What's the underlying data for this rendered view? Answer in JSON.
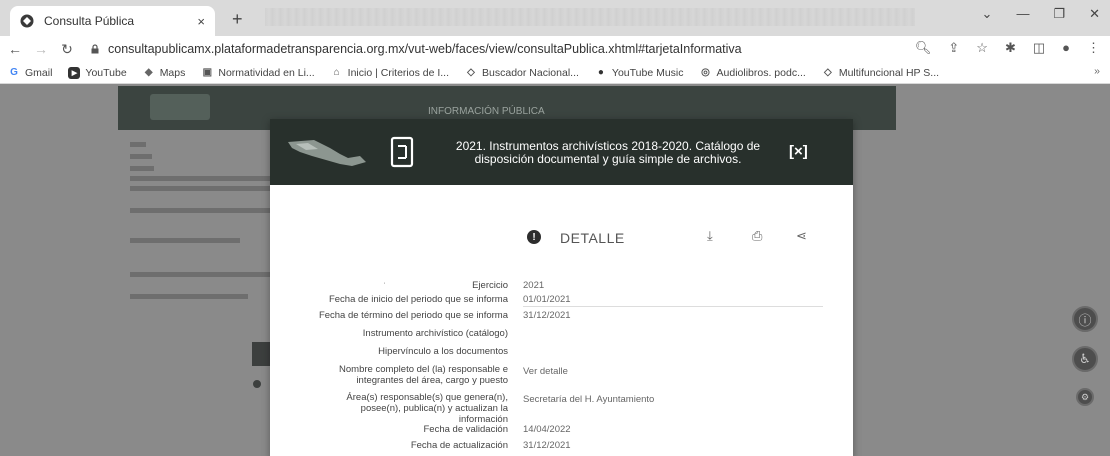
{
  "browser": {
    "tab_title": "Consulta Pública",
    "tab_close": "×",
    "new_tab": "+",
    "url": "consultapublicamx.plataformadetransparencia.org.mx/vut-web/faces/view/consultaPublica.xhtml#tarjetaInformativa",
    "bookmarks": [
      {
        "label": "Gmail",
        "icon": "G"
      },
      {
        "label": "YouTube",
        "icon": "▶"
      },
      {
        "label": "Maps",
        "icon": "◆"
      },
      {
        "label": "Normatividad en Li...",
        "icon": "▣"
      },
      {
        "label": "Inicio | Criterios de I...",
        "icon": "⌂"
      },
      {
        "label": "Buscador Nacional...",
        "icon": "◇"
      },
      {
        "label": "YouTube Music",
        "icon": "●"
      },
      {
        "label": "Audiolibros. podc...",
        "icon": "◎"
      },
      {
        "label": "Multifuncional HP S...",
        "icon": "◇"
      }
    ],
    "bookmarks_more": "»"
  },
  "background_page": {
    "header_title": "INFORMACIÓN PÚBLICA"
  },
  "modal": {
    "title_line1": "2021. Instrumentos archivísticos 2018-2020. Catálogo de",
    "title_line2": "disposición documental y guía simple de archivos.",
    "close_label": "[×]",
    "detail_label": "DETALLE",
    "rows": [
      {
        "label": "Ejercicio",
        "value": "2021"
      },
      {
        "label": "Fecha de inicio del periodo que se informa",
        "value": "01/01/2021"
      },
      {
        "label": "Fecha de término del periodo que se informa",
        "value": "31/12/2021"
      },
      {
        "label": "Instrumento archivístico (catálogo)",
        "value": ""
      },
      {
        "label": "Hipervínculo a los documentos",
        "value": ""
      },
      {
        "label": "Nombre completo del (la) responsable e integrantes del área, cargo y puesto",
        "value": "Ver detalle"
      },
      {
        "label": "Área(s) responsable(s) que genera(n), posee(n), publica(n) y actualizan la información",
        "value": "Secretaría del H. Ayuntamiento"
      },
      {
        "label": "Fecha de validación",
        "value": "14/04/2022"
      },
      {
        "label": "Fecha de actualización",
        "value": "31/12/2021"
      }
    ]
  },
  "colors": {
    "header_dark": "#28302c",
    "overlay_gray": "#8a8a8a"
  }
}
